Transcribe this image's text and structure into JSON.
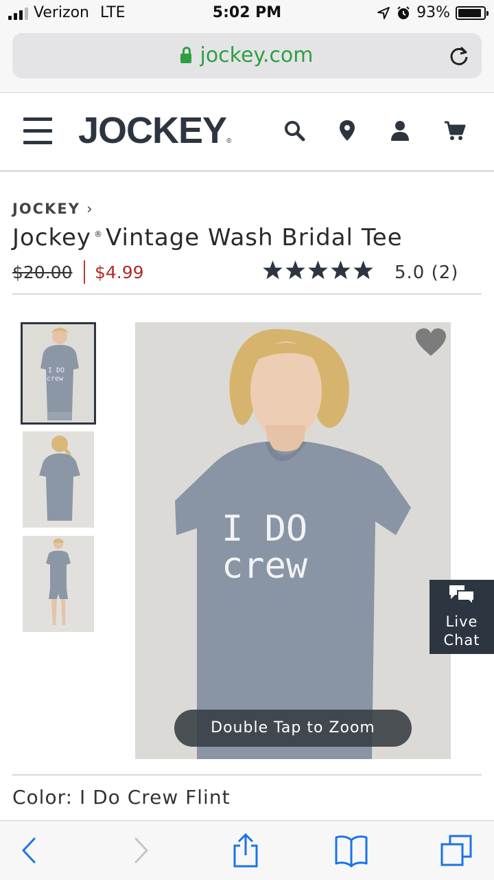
{
  "status": {
    "carrier": "Verizon",
    "network": "LTE",
    "time": "5:02 PM",
    "battery": "93%",
    "battery_level": 0.93
  },
  "browser": {
    "url": "jockey.com"
  },
  "header": {
    "logo": "JOCKEY",
    "logo_mark": "®"
  },
  "product": {
    "breadcrumb": "JOCKEY",
    "breadcrumb_arrow": "›",
    "title_brand": "Jockey",
    "title_mark": "®",
    "title_rest": "Vintage Wash Bridal Tee",
    "price_original": "$20.00",
    "price_sale": "$4.99",
    "rating_value": "5.0",
    "rating_count": "(2)",
    "stars": 5,
    "color_label": "Color: I Do Crew Flint",
    "shirt_text_line1": "I DO",
    "shirt_text_line2": "crew"
  },
  "gallery": {
    "zoom_hint": "Double Tap to Zoom",
    "thumb_count": 3,
    "active_thumb": 1
  },
  "chat": {
    "line1": "Live",
    "line2": "Chat"
  },
  "colors": {
    "brand_dark": "#2d3540",
    "sale_red": "#b22a2a",
    "url_green": "#2ea043",
    "ios_blue": "#1a73e8"
  }
}
